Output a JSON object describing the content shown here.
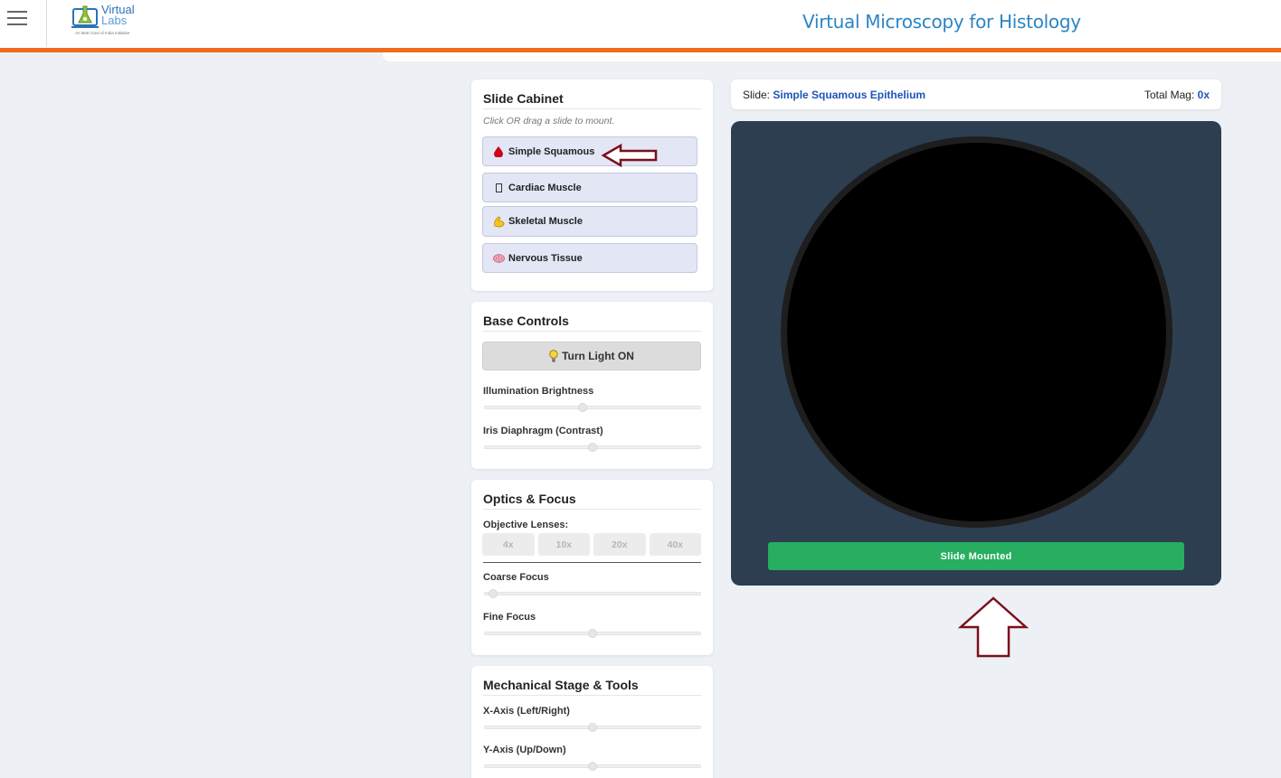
{
  "header": {
    "logo": {
      "line1": "Virtual",
      "line2": "Labs",
      "tagline": "An MoE Govt of India Initiative"
    },
    "title": "Virtual Microscopy for Histology"
  },
  "slide_cabinet": {
    "title": "Slide Cabinet",
    "hint": "Click OR drag a slide to mount.",
    "slides": [
      {
        "label": "Simple Squamous",
        "icon": "blood-drop-icon"
      },
      {
        "label": "Cardiac Muscle",
        "icon": "missing-glyph-icon"
      },
      {
        "label": "Skeletal Muscle",
        "icon": "flexed-biceps-icon"
      },
      {
        "label": "Nervous Tissue",
        "icon": "brain-icon"
      }
    ]
  },
  "base_controls": {
    "title": "Base Controls",
    "light_button": "Turn Light ON",
    "illumination_label": "Illumination Brightness",
    "illumination_value": 0.45,
    "iris_label": "Iris Diaphragm (Contrast)",
    "iris_value": 0.5
  },
  "optics": {
    "title": "Optics & Focus",
    "lenses_label": "Objective Lenses:",
    "lenses": [
      "4x",
      "10x",
      "20x",
      "40x"
    ],
    "coarse_label": "Coarse Focus",
    "coarse_value": 0.02,
    "fine_label": "Fine Focus",
    "fine_value": 0.5
  },
  "stage_tools": {
    "title": "Mechanical Stage & Tools",
    "x_label": "X-Axis (Left/Right)",
    "x_value": 0.5,
    "y_label": "Y-Axis (Up/Down)",
    "y_value": 0.5
  },
  "viewer": {
    "slide_prefix": "Slide:",
    "slide_name": "Simple Squamous Epithelium",
    "mag_prefix": "Total Mag:",
    "mag_value": "0x",
    "status_button": "Slide Mounted"
  },
  "colors": {
    "accent_orange": "#f26b1d",
    "stage_bg": "#2c3e50",
    "success_green": "#27ae60",
    "annotation_arrow": "#7b0f1d"
  }
}
